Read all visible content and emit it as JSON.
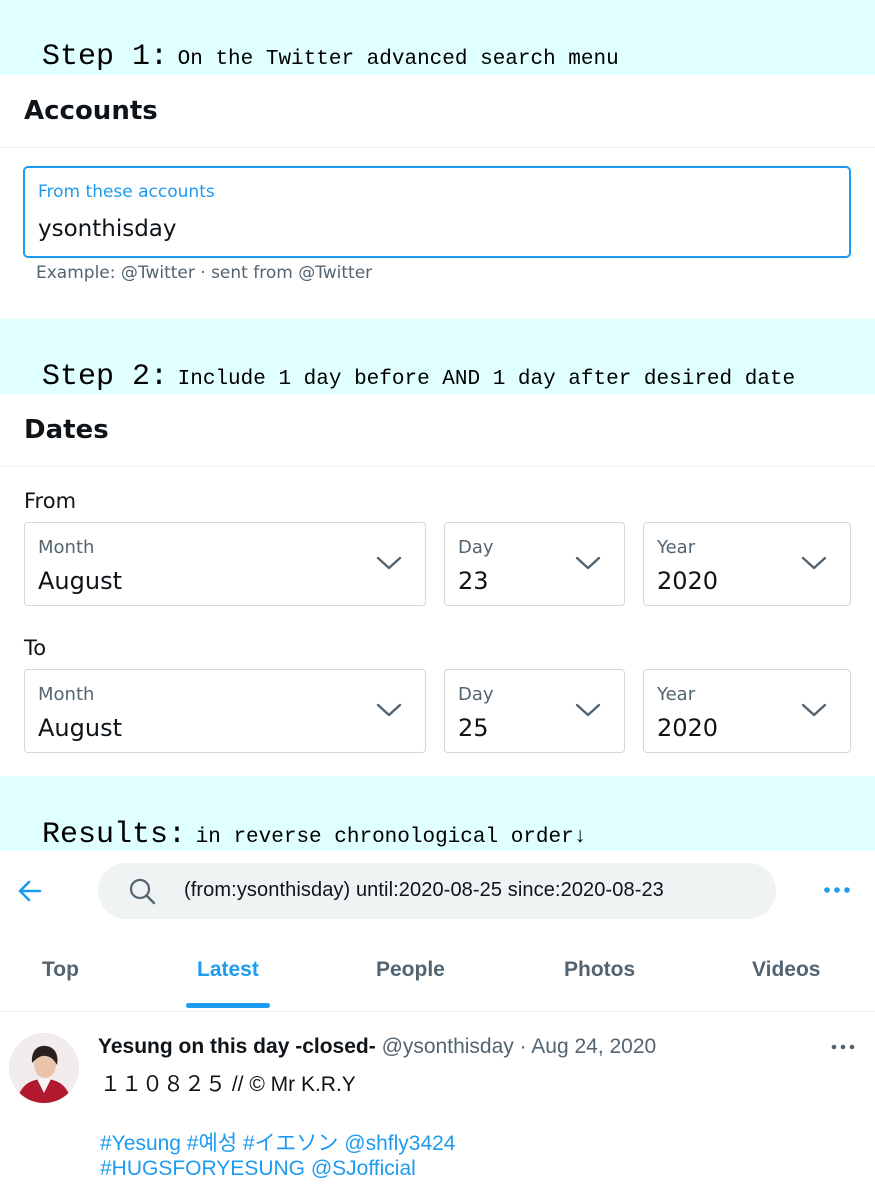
{
  "step1": {
    "label": "Step 1:",
    "text": "On the Twitter advanced search menu"
  },
  "accounts": {
    "heading": "Accounts",
    "field_label": "From these accounts",
    "field_value": "ysonthisday",
    "help": "Example: @Twitter · sent from @Twitter"
  },
  "step2": {
    "label": "Step 2:",
    "text": "Include 1 day before AND 1 day after desired date"
  },
  "dates": {
    "heading": "Dates",
    "from": {
      "label": "From",
      "month_label": "Month",
      "month_value": "August",
      "day_label": "Day",
      "day_value": "23",
      "year_label": "Year",
      "year_value": "2020"
    },
    "to": {
      "label": "To",
      "month_label": "Month",
      "month_value": "August",
      "day_label": "Day",
      "day_value": "25",
      "year_label": "Year",
      "year_value": "2020"
    }
  },
  "results": {
    "label": "Results:",
    "text": "in reverse chronological order↓"
  },
  "search": {
    "query": "(from:ysonthisday) until:2020-08-25 since:2020-08-23"
  },
  "tabs": [
    {
      "label": "Top"
    },
    {
      "label": "Latest"
    },
    {
      "label": "People"
    },
    {
      "label": "Photos"
    },
    {
      "label": "Videos"
    }
  ],
  "tweet": {
    "name": "Yesung on this day -closed-",
    "meta": "@ysonthisday · Aug 24, 2020",
    "line1": "１１０８２５ // © Mr K.R.Y",
    "line2": "#Yesung #예성 #イエソン @shfly3424",
    "line3": "#HUGSFORYESUNG @SJofficial"
  },
  "colors": {
    "accent": "#1d9bf0",
    "banner": "#e0ffff",
    "muted": "#536471",
    "border": "#cfd9de"
  },
  "icons": [
    "back-arrow-icon",
    "search-icon",
    "more-icon",
    "chevron-down-icon",
    "tweet-more-icon"
  ]
}
